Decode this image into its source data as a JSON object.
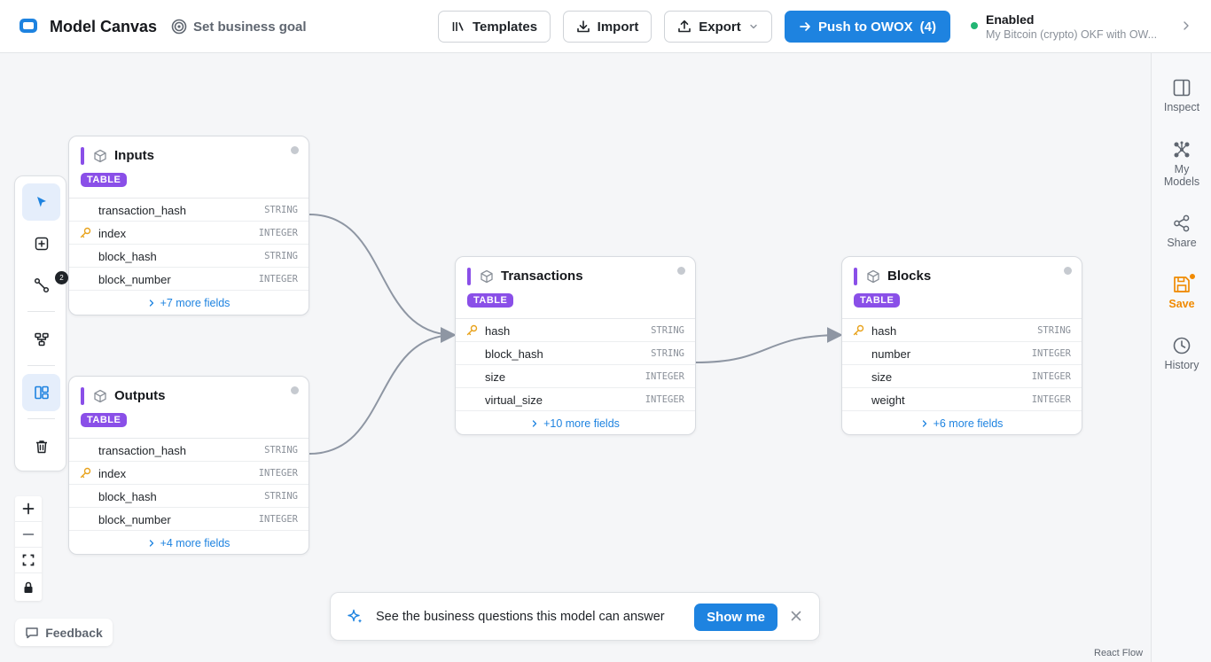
{
  "header": {
    "app_title": "Model Canvas",
    "goal_label": "Set business goal",
    "templates_label": "Templates",
    "import_label": "Import",
    "export_label": "Export",
    "push_label": "Push to OWOX",
    "push_count": "(4)",
    "status_title": "Enabled",
    "status_subtitle": "My Bitcoin (crypto) OKF with OW..."
  },
  "right_sidebar": {
    "inspect": "Inspect",
    "my_models_1": "My",
    "my_models_2": "Models",
    "share": "Share",
    "save": "Save",
    "history": "History"
  },
  "toolbar": {
    "connect_badge": "2"
  },
  "feedback_label": "Feedback",
  "nodes": {
    "inputs": {
      "title": "Inputs",
      "tag": "TABLE",
      "fields": [
        {
          "name": "transaction_hash",
          "type": "STRING"
        },
        {
          "name": "index",
          "type": "INTEGER"
        },
        {
          "name": "block_hash",
          "type": "STRING"
        },
        {
          "name": "block_number",
          "type": "INTEGER"
        }
      ],
      "more": "+7 more fields"
    },
    "outputs": {
      "title": "Outputs",
      "tag": "TABLE",
      "fields": [
        {
          "name": "transaction_hash",
          "type": "STRING"
        },
        {
          "name": "index",
          "type": "INTEGER"
        },
        {
          "name": "block_hash",
          "type": "STRING"
        },
        {
          "name": "block_number",
          "type": "INTEGER"
        }
      ],
      "more": "+4 more fields"
    },
    "transactions": {
      "title": "Transactions",
      "tag": "TABLE",
      "fields": [
        {
          "name": "hash",
          "type": "STRING"
        },
        {
          "name": "block_hash",
          "type": "STRING"
        },
        {
          "name": "size",
          "type": "INTEGER"
        },
        {
          "name": "virtual_size",
          "type": "INTEGER"
        }
      ],
      "more": "+10 more fields"
    },
    "blocks": {
      "title": "Blocks",
      "tag": "TABLE",
      "fields": [
        {
          "name": "hash",
          "type": "STRING"
        },
        {
          "name": "number",
          "type": "INTEGER"
        },
        {
          "name": "size",
          "type": "INTEGER"
        },
        {
          "name": "weight",
          "type": "INTEGER"
        }
      ],
      "more": "+6 more fields"
    }
  },
  "prompt": {
    "text": "See the business questions this model can answer",
    "button": "Show me"
  },
  "attribution": "React Flow",
  "colors": {
    "accent": "#1e83e0",
    "table_tag": "#8a4fe8",
    "save": "#f08a00",
    "status": "#22b573"
  }
}
